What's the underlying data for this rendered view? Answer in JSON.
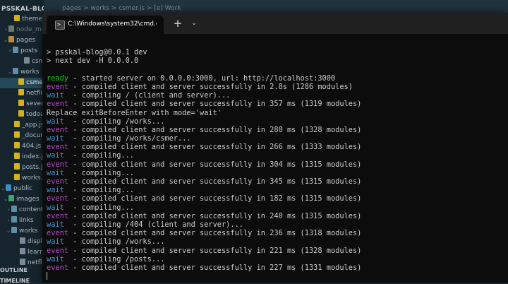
{
  "explorer": {
    "title": "PSSKAL-BLOG",
    "items": [
      {
        "label": "theme.js"
      },
      {
        "label": "node_modules"
      },
      {
        "label": "pages"
      },
      {
        "label": "posts"
      },
      {
        "label": "csmer.md"
      },
      {
        "label": "works"
      },
      {
        "label": "csmer.js"
      },
      {
        "label": "netflix.js"
      },
      {
        "label": "sevenSeas.js"
      },
      {
        "label": "todoapp.js"
      },
      {
        "label": "_app.js"
      },
      {
        "label": "_document.js"
      },
      {
        "label": "404.js"
      },
      {
        "label": "index.js"
      },
      {
        "label": "posts.js"
      },
      {
        "label": "works.js"
      },
      {
        "label": "public"
      },
      {
        "label": "images"
      },
      {
        "label": "contents"
      },
      {
        "label": "links"
      },
      {
        "label": "works"
      },
      {
        "label": "display.png"
      },
      {
        "label": "learning.png"
      },
      {
        "label": "netflix_.png"
      }
    ],
    "outline_label": "OUTLINE",
    "timeline_label": "TIMELINE"
  },
  "breadcrumb": "pages > works > csmer.js > [e] Work",
  "terminal": {
    "tab_title": "C:\\Windows\\system32\\cmd.exe",
    "new_tab_label": "+",
    "dropdown_label": "⌄",
    "lines": [
      {
        "tag": "",
        "text": ""
      },
      {
        "tag": "",
        "text": "> psskal-blog@0.0.1 dev"
      },
      {
        "tag": "",
        "text": "> next dev -H 0.0.0.0"
      },
      {
        "tag": "",
        "text": ""
      },
      {
        "tag": "ready",
        "text": " - started server on 0.0.0.0:3000, url: http://localhost:3000"
      },
      {
        "tag": "event",
        "text": " - compiled client and server successfully in 2.8s (1286 modules)"
      },
      {
        "tag": "wait",
        "text": "  - compiling / (client and server)..."
      },
      {
        "tag": "event",
        "text": " - compiled client and server successfully in 357 ms (1319 modules)"
      },
      {
        "tag": "",
        "text": "Replace exitBeforeEnter with mode='wait'"
      },
      {
        "tag": "wait",
        "text": "  - compiling /works..."
      },
      {
        "tag": "event",
        "text": " - compiled client and server successfully in 280 ms (1328 modules)"
      },
      {
        "tag": "wait",
        "text": "  - compiling /works/csmer..."
      },
      {
        "tag": "event",
        "text": " - compiled client and server successfully in 266 ms (1333 modules)"
      },
      {
        "tag": "wait",
        "text": "  - compiling..."
      },
      {
        "tag": "event",
        "text": " - compiled client and server successfully in 304 ms (1315 modules)"
      },
      {
        "tag": "wait",
        "text": "  - compiling..."
      },
      {
        "tag": "event",
        "text": " - compiled client and server successfully in 345 ms (1315 modules)"
      },
      {
        "tag": "wait",
        "text": "  - compiling..."
      },
      {
        "tag": "event",
        "text": " - compiled client and server successfully in 182 ms (1315 modules)"
      },
      {
        "tag": "wait",
        "text": "  - compiling..."
      },
      {
        "tag": "event",
        "text": " - compiled client and server successfully in 240 ms (1315 modules)"
      },
      {
        "tag": "wait",
        "text": "  - compiling /404 (client and server)..."
      },
      {
        "tag": "event",
        "text": " - compiled client and server successfully in 236 ms (1318 modules)"
      },
      {
        "tag": "wait",
        "text": "  - compiling /works..."
      },
      {
        "tag": "event",
        "text": " - compiled client and server successfully in 221 ms (1328 modules)"
      },
      {
        "tag": "wait",
        "text": "  - compiling /posts..."
      },
      {
        "tag": "event",
        "text": " - compiled client and server successfully in 227 ms (1331 modules)"
      }
    ]
  },
  "colors": {
    "ready": "#16c60c",
    "event": "#b148c6",
    "wait": "#3a96dd",
    "terminal_bg": "#0c0c0c",
    "terminal_fg": "#cccccc"
  }
}
